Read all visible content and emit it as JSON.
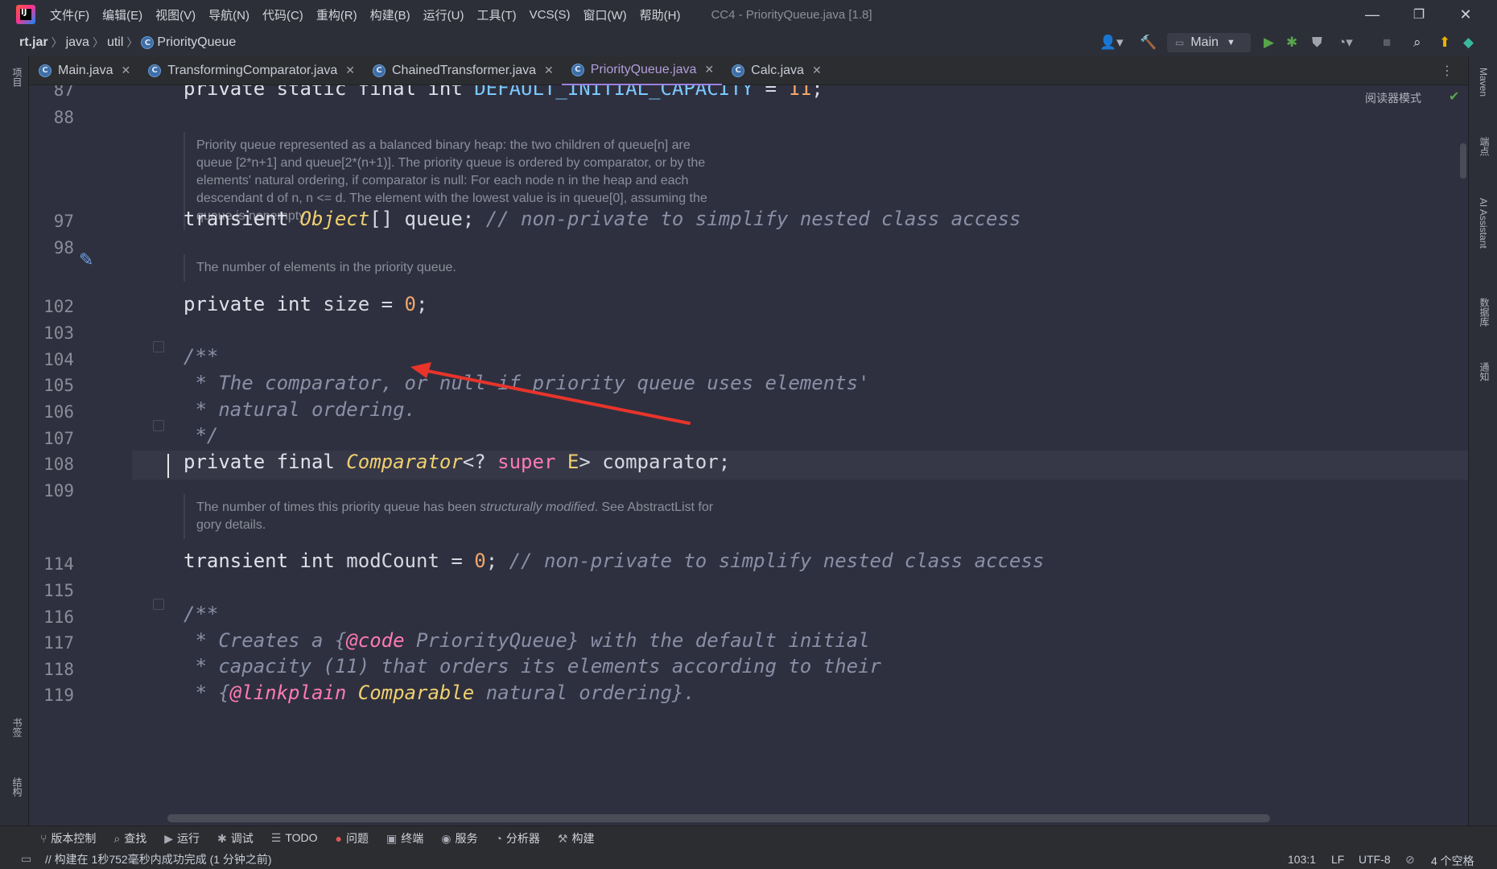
{
  "titlebar": {
    "menus": [
      "文件(F)",
      "编辑(E)",
      "视图(V)",
      "导航(N)",
      "代码(C)",
      "重构(R)",
      "构建(B)",
      "运行(U)",
      "工具(T)",
      "VCS(S)",
      "窗口(W)",
      "帮助(H)"
    ],
    "window_title": "CC4 - PriorityQueue.java [1.8]",
    "controls": {
      "minimize": "—",
      "restore": "❐",
      "close": "✕"
    }
  },
  "navbar": {
    "breadcrumb": [
      "rt.jar",
      "java",
      "util",
      "PriorityQueue"
    ],
    "run_config": "Main"
  },
  "tabs": [
    {
      "label": "Main.java",
      "active": false
    },
    {
      "label": "TransformingComparator.java",
      "active": false
    },
    {
      "label": "ChainedTransformer.java",
      "active": false
    },
    {
      "label": "PriorityQueue.java",
      "active": true
    },
    {
      "label": "Calc.java",
      "active": false
    }
  ],
  "left_strip": {
    "project": "项目",
    "bookmarks": "书签",
    "structure": "结构"
  },
  "right_strip": {
    "maven": "Maven",
    "endpoints": "端点",
    "ai": "AI Assistant",
    "database": "数据库",
    "notifications": "通知"
  },
  "editor": {
    "reader_mode": "阅读器模式",
    "lines": {
      "l87": "87",
      "l88": "88",
      "l97": "97",
      "l98": "98",
      "l102": "102",
      "l103": "103",
      "l104": "104",
      "l105": "105",
      "l106": "106",
      "l107": "107",
      "l108": "108",
      "l109": "109",
      "l114": "114",
      "l115": "115",
      "l116": "116",
      "l117": "117",
      "l118": "118",
      "l119": "119"
    },
    "docs": {
      "queue": "Priority queue represented as a balanced binary heap: the two children of queue[n] are queue [2*n+1] and queue[2*(n+1)]. The priority queue is ordered by comparator, or by the elements' natural ordering, if comparator is null: For each node n in the heap and each descendant d of n, n <= d. The element with the lowest value is in queue[0], assuming the queue is nonempty.",
      "size": "The number of elements in the priority queue.",
      "modcount_a": "The number of times this priority queue has been ",
      "modcount_em": "structurally modified",
      "modcount_b": ". See AbstractList for gory details."
    }
  },
  "bottom_tools": [
    "版本控制",
    "查找",
    "运行",
    "调试",
    "TODO",
    "问题",
    "终端",
    "服务",
    "分析器",
    "构建"
  ],
  "statusbar": {
    "message": "// 构建在 1秒752毫秒内成功完成 (1 分钟之前)",
    "position": "103:1",
    "line_sep": "LF",
    "encoding": "UTF-8",
    "indent": "4 个空格"
  },
  "colors": {
    "keyword": "#ff7ab2",
    "number": "#f2a66c",
    "constant": "#7cc7ff",
    "type": "#f1d06e",
    "comment": "#8a8fa6",
    "annotation_arrow": "#e8342b",
    "active_tab": "#b39ddb"
  }
}
